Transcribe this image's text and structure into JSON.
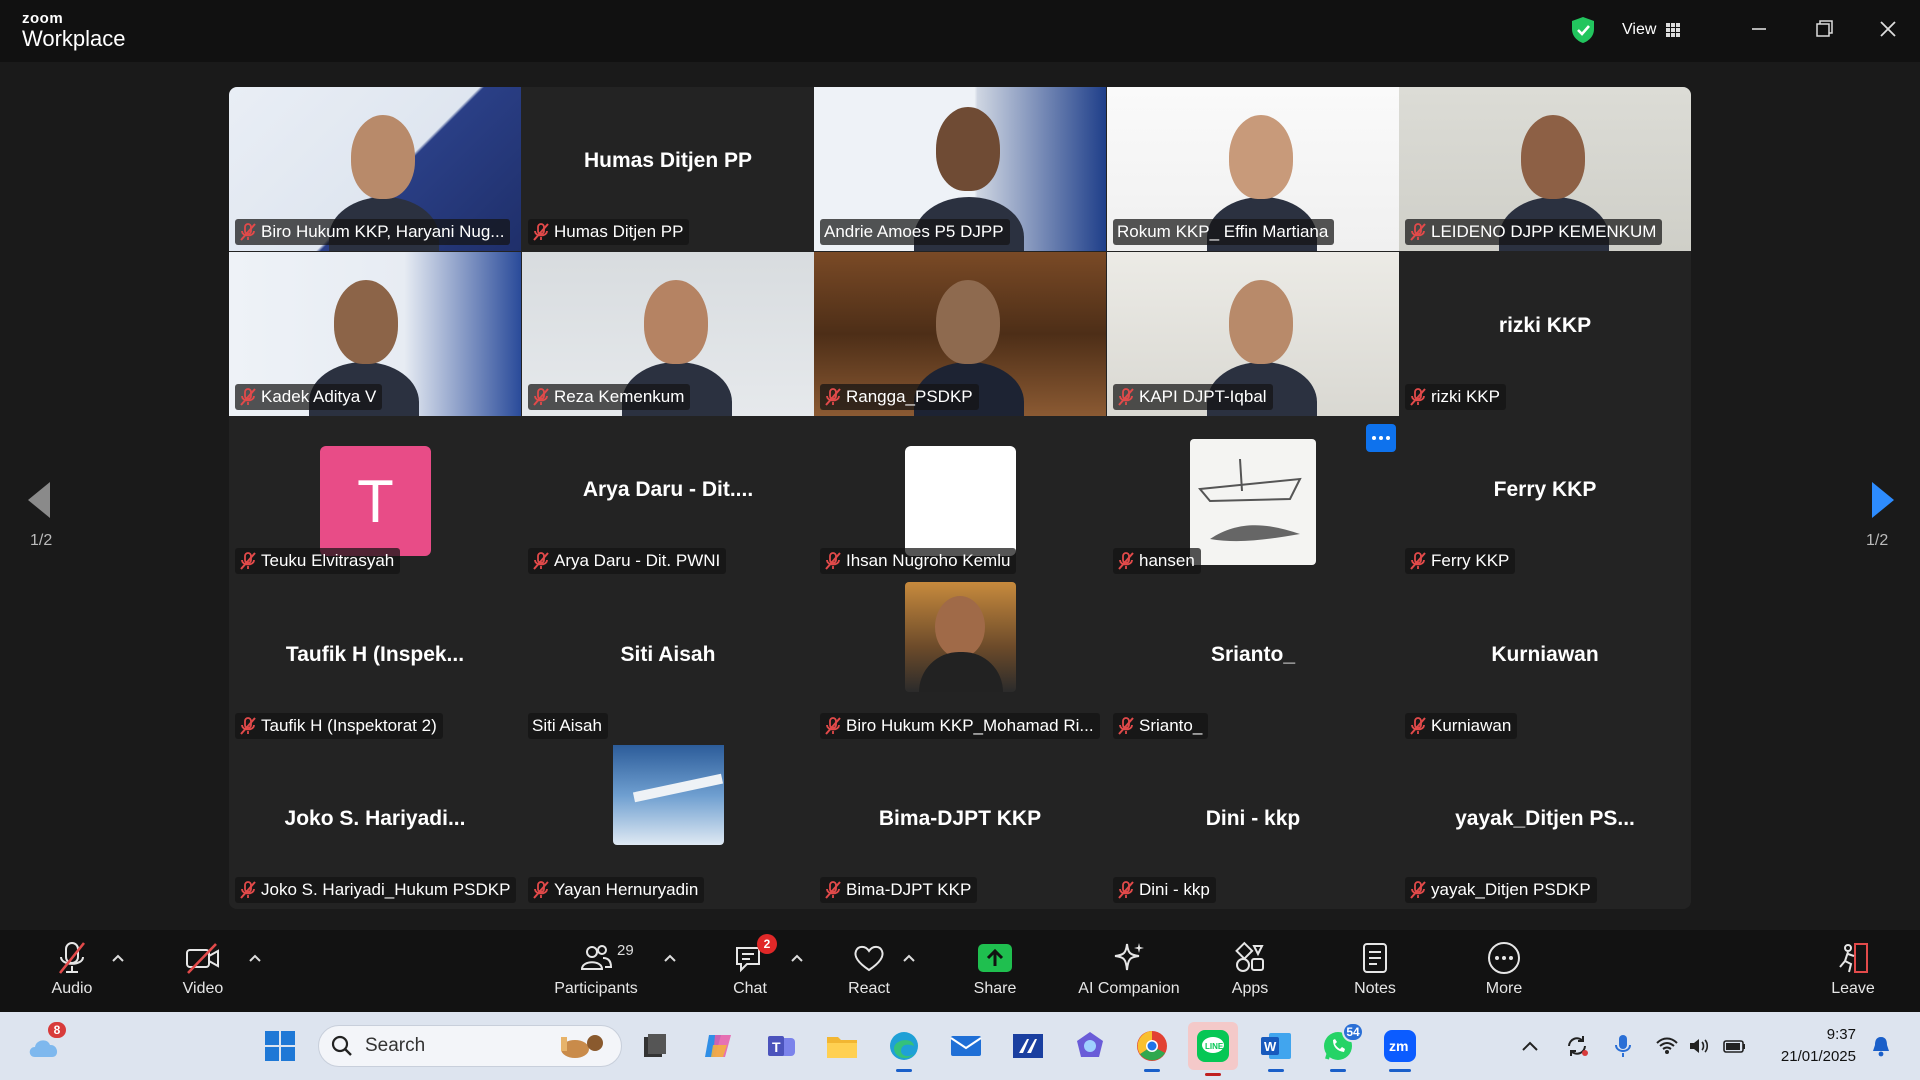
{
  "app": {
    "brand_top": "zoom",
    "brand_bottom": "Workplace",
    "view_label": "View"
  },
  "pagination": {
    "left": "1/2",
    "right": "1/2"
  },
  "tiles": [
    {
      "label": "Biro Hukum KKP, Haryani Nug...",
      "muted": true,
      "type": "video"
    },
    {
      "label": "Humas Ditjen PP",
      "big": "Humas Ditjen PP",
      "muted": true,
      "type": "name"
    },
    {
      "label": "Andrie Amoes P5 DJPP",
      "muted": false,
      "type": "video",
      "active": true
    },
    {
      "label": "Rokum KKP_ Effin Martiana",
      "muted": false,
      "type": "video"
    },
    {
      "label": "LEIDENO DJPP KEMENKUM",
      "muted": true,
      "type": "video"
    },
    {
      "label": "Kadek Aditya V",
      "muted": true,
      "type": "video"
    },
    {
      "label": "Reza Kemenkum",
      "muted": true,
      "type": "video"
    },
    {
      "label": "Rangga_PSDKP",
      "muted": true,
      "type": "video"
    },
    {
      "label": "KAPI DJPT-Iqbal",
      "muted": true,
      "type": "video"
    },
    {
      "label": "rizki KKP",
      "big": "rizki KKP",
      "muted": true,
      "type": "name"
    },
    {
      "label": "Teuku Elvitrasyah",
      "avatar": "T",
      "muted": true,
      "type": "avatar"
    },
    {
      "label": "Arya Daru - Dit. PWNI",
      "big": "Arya Daru - Dit....",
      "muted": true,
      "type": "name"
    },
    {
      "label": "Ihsan Nugroho Kemlu",
      "muted": true,
      "type": "white"
    },
    {
      "label": "hansen",
      "muted": true,
      "type": "sketch"
    },
    {
      "label": "Ferry KKP",
      "big": "Ferry KKP",
      "muted": true,
      "type": "name"
    },
    {
      "label": "Taufik H (Inspektorat 2)",
      "big": "Taufik H (Inspek...",
      "muted": true,
      "type": "name"
    },
    {
      "label": "Siti Aisah",
      "big": "Siti Aisah",
      "muted": false,
      "type": "name"
    },
    {
      "label": "Biro Hukum KKP_Mohamad Ri...",
      "muted": true,
      "type": "photo"
    },
    {
      "label": "Srianto_",
      "big": "Srianto_",
      "muted": true,
      "type": "name"
    },
    {
      "label": "Kurniawan",
      "big": "Kurniawan",
      "muted": true,
      "type": "name"
    },
    {
      "label": "Joko S. Hariyadi_Hukum PSDKP",
      "big": "Joko S. Hariyadi...",
      "muted": true,
      "type": "name"
    },
    {
      "label": "Yayan Hernuryadin",
      "muted": true,
      "type": "sky"
    },
    {
      "label": "Bima-DJPT KKP",
      "big": "Bima-DJPT KKP",
      "muted": true,
      "type": "name"
    },
    {
      "label": "Dini - kkp",
      "big": "Dini - kkp",
      "muted": true,
      "type": "name"
    },
    {
      "label": "yayak_Ditjen PSDKP",
      "big": "yayak_Ditjen  PS...",
      "muted": true,
      "type": "name"
    }
  ],
  "toolbar": {
    "audio": "Audio",
    "video": "Video",
    "participants": "Participants",
    "participants_count": "29",
    "chat": "Chat",
    "chat_badge": "2",
    "react": "React",
    "share": "Share",
    "ai": "AI Companion",
    "apps": "Apps",
    "notes": "Notes",
    "more": "More",
    "leave": "Leave"
  },
  "taskbar": {
    "weather_badge": "8",
    "search_placeholder": "Search",
    "whatsapp_badge": "54",
    "time": "9:37",
    "date": "21/01/2025"
  },
  "colors": {
    "active_speaker": "#2ecc71",
    "share_green": "#1fbf4f",
    "accent_blue": "#0e72ed",
    "avatar_pink": "#e84c87"
  }
}
